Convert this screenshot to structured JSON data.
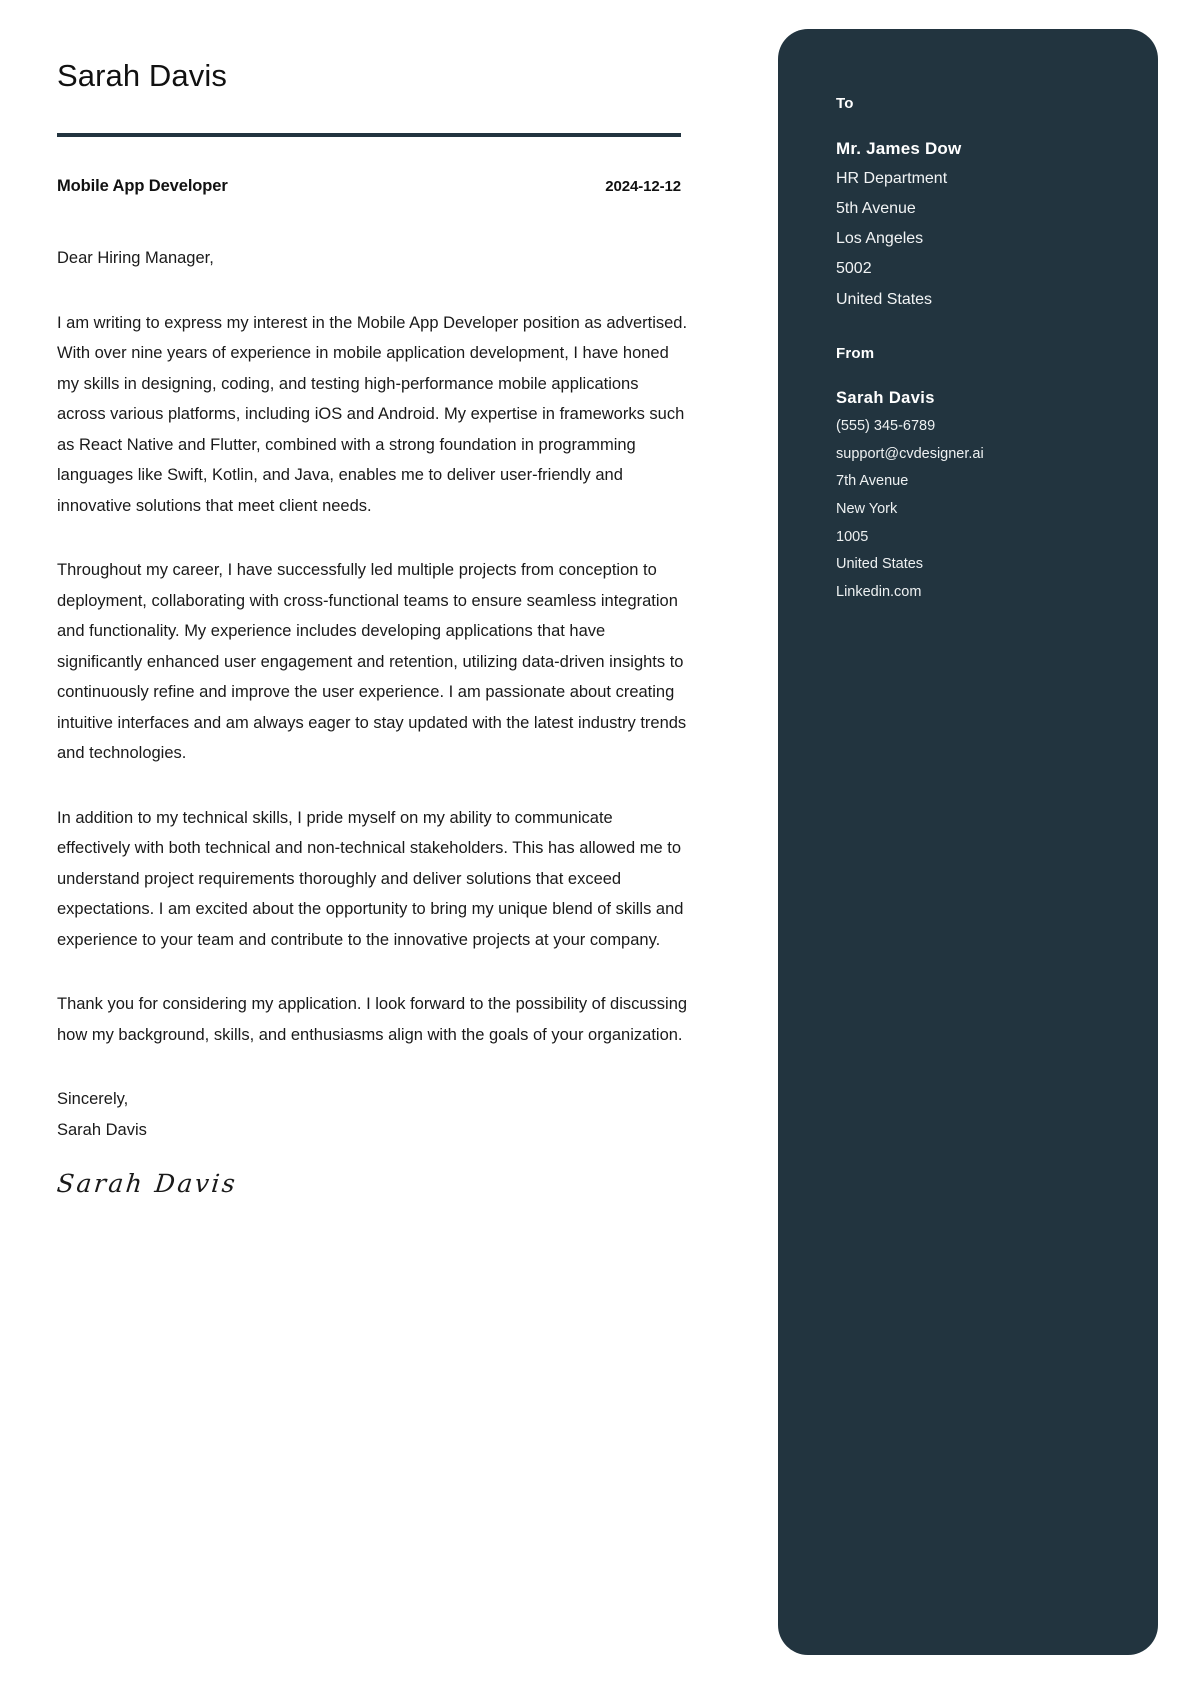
{
  "letter": {
    "applicant_name": "Sarah Davis",
    "job_title": "Mobile App Developer",
    "date": "2024-12-12",
    "salutation": "Dear Hiring Manager,",
    "paragraphs": [
      "I am writing to express my interest in the Mobile App Developer position as advertised. With over nine years of experience in mobile application development, I have honed my skills in designing, coding, and testing high-performance mobile applications across various platforms, including iOS and Android. My expertise in frameworks such as React Native and Flutter, combined with a strong foundation in programming languages like Swift, Kotlin, and Java, enables me to deliver user-friendly and innovative solutions that meet client needs.",
      "Throughout my career, I have successfully led multiple projects from conception to deployment, collaborating with cross-functional teams to ensure seamless integration and functionality. My experience includes developing applications that have significantly enhanced user engagement and retention, utilizing data-driven insights to continuously refine and improve the user experience. I am passionate about creating intuitive interfaces and am always eager to stay updated with the latest industry trends and technologies.",
      "In addition to my technical skills, I pride myself on my ability to communicate effectively with both technical and non-technical stakeholders. This has allowed me to understand project requirements thoroughly and deliver solutions that exceed expectations. I am excited about the opportunity to bring my unique blend of skills and experience to your team and contribute to the innovative projects at your company.",
      "Thank you for considering my application. I look forward to the possibility of discussing how my background, skills, and enthusiasms align with the goals of your organization."
    ],
    "closing_word": "Sincerely,",
    "closing_name": "Sarah Davis",
    "signature": "Sarah Davis"
  },
  "sidebar": {
    "to": {
      "heading": "To",
      "name": "Mr. James Dow",
      "lines": [
        "HR Department",
        "5th Avenue",
        "Los Angeles",
        "5002",
        "United States"
      ]
    },
    "from": {
      "heading": "From",
      "name": "Sarah Davis",
      "lines": [
        "(555) 345-6789",
        "support@cvdesigner.ai",
        "7th Avenue",
        "New York",
        "1005",
        "United States",
        "Linkedin.com"
      ]
    }
  },
  "colors": {
    "panel_background": "#22343f",
    "rule": "#22343f",
    "body_text": "#1a1a1a",
    "page_background": "#ffffff"
  }
}
